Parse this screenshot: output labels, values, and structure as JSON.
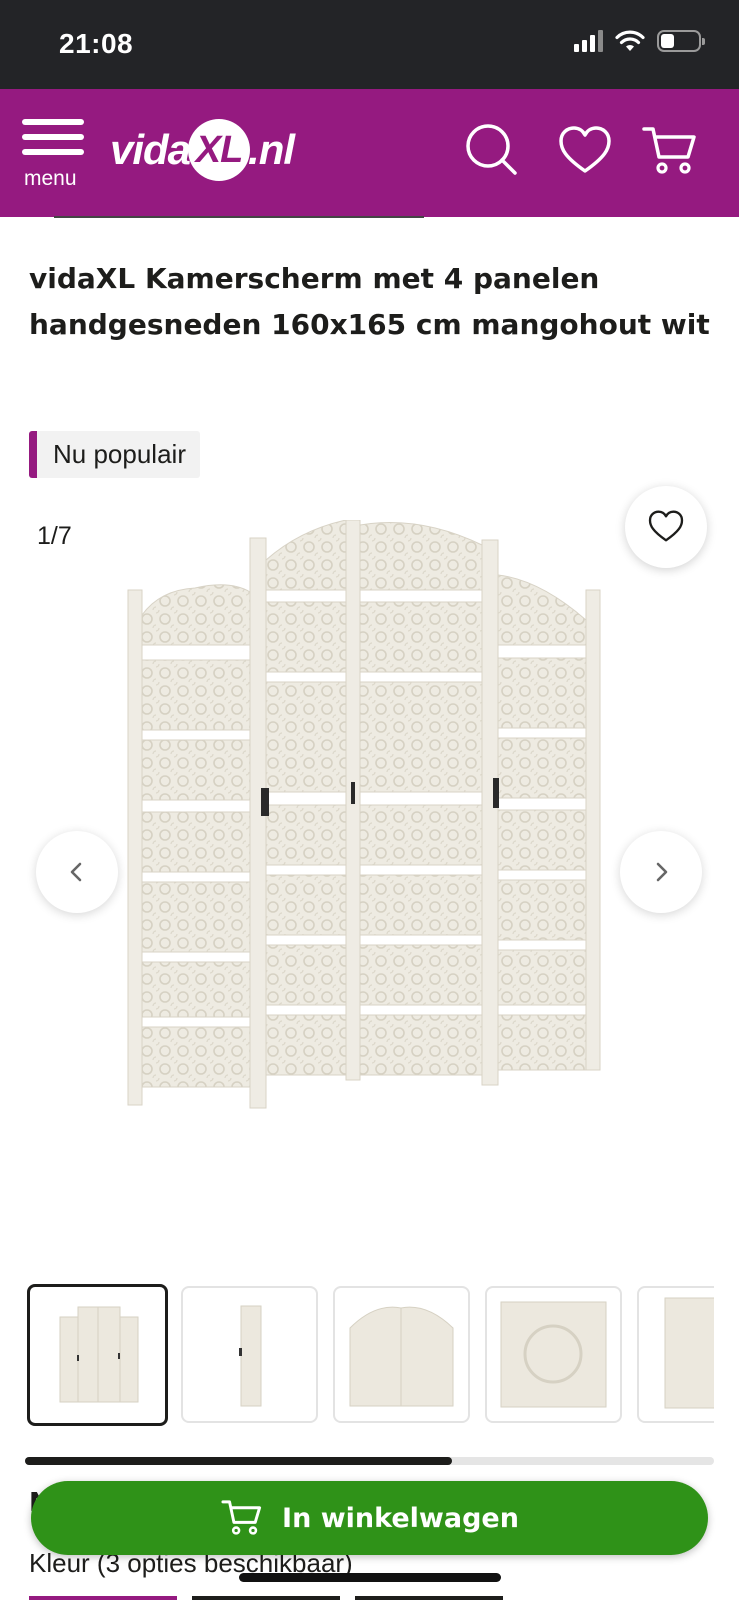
{
  "status_bar": {
    "time": "21:08",
    "battery_level": 0.35,
    "signal_icon": "signal-icon",
    "wifi_icon": "wifi-icon",
    "battery_icon": "battery-icon"
  },
  "header": {
    "menu_label": "menu",
    "logo": "vidaXL.nl",
    "icons": [
      "search-icon",
      "heart-icon",
      "cart-icon"
    ],
    "background_color": "#951a80"
  },
  "product": {
    "title": "vidaXL Kamerscherm met 4 panelen handgesneden 160x165 cm mangohout wit",
    "badge": "Nu populair"
  },
  "gallery": {
    "counter": "1/7",
    "thumbnails": [
      "thumb-front",
      "thumb-side",
      "thumb-top",
      "thumb-detail",
      "thumb-partial"
    ],
    "active_index": 0,
    "scroll_progress": 0.62
  },
  "actions": {
    "add_to_cart": "In winkelwagen",
    "add_to_cart_color": "#2f9218"
  },
  "options": {
    "hidden_heading_peek": "N",
    "color_line": "Kleur (3 opties beschikbaar)"
  }
}
